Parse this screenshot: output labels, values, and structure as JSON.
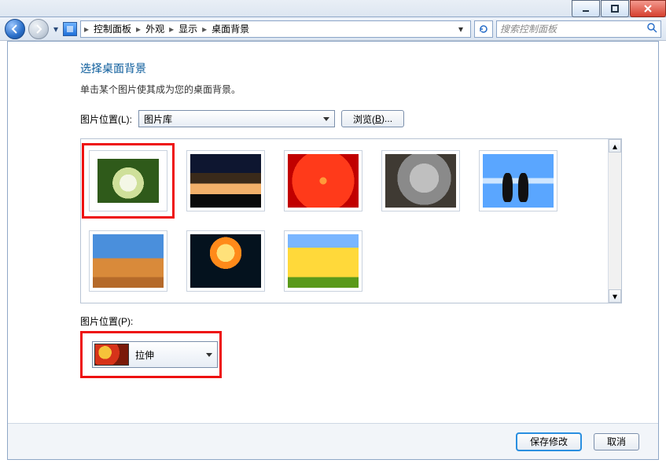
{
  "window": {
    "min_tip": "Minimize",
    "max_tip": "Maximize",
    "close_tip": "Close"
  },
  "breadcrumb": {
    "items": [
      "控制面板",
      "外观",
      "显示",
      "桌面背景"
    ]
  },
  "search": {
    "placeholder": "搜索控制面板"
  },
  "heading": "选择桌面背景",
  "subtext": "单击某个图片使其成为您的桌面背景。",
  "location": {
    "label": "图片位置(L):",
    "value": "图片库",
    "browse_pre": "浏览(",
    "browse_key": "B",
    "browse_post": ")..."
  },
  "thumbs": {
    "0": "hydrangea-flower",
    "1": "lighthouse-sunset",
    "2": "red-dahlia",
    "3": "koala",
    "4": "penguins",
    "5": "desert-mesa",
    "6": "jellyfish",
    "7": "yellow-tulips",
    "selected_index": 0
  },
  "position": {
    "label": "图片位置(P):",
    "value": "拉伸"
  },
  "footer": {
    "save": "保存修改",
    "cancel": "取消"
  }
}
